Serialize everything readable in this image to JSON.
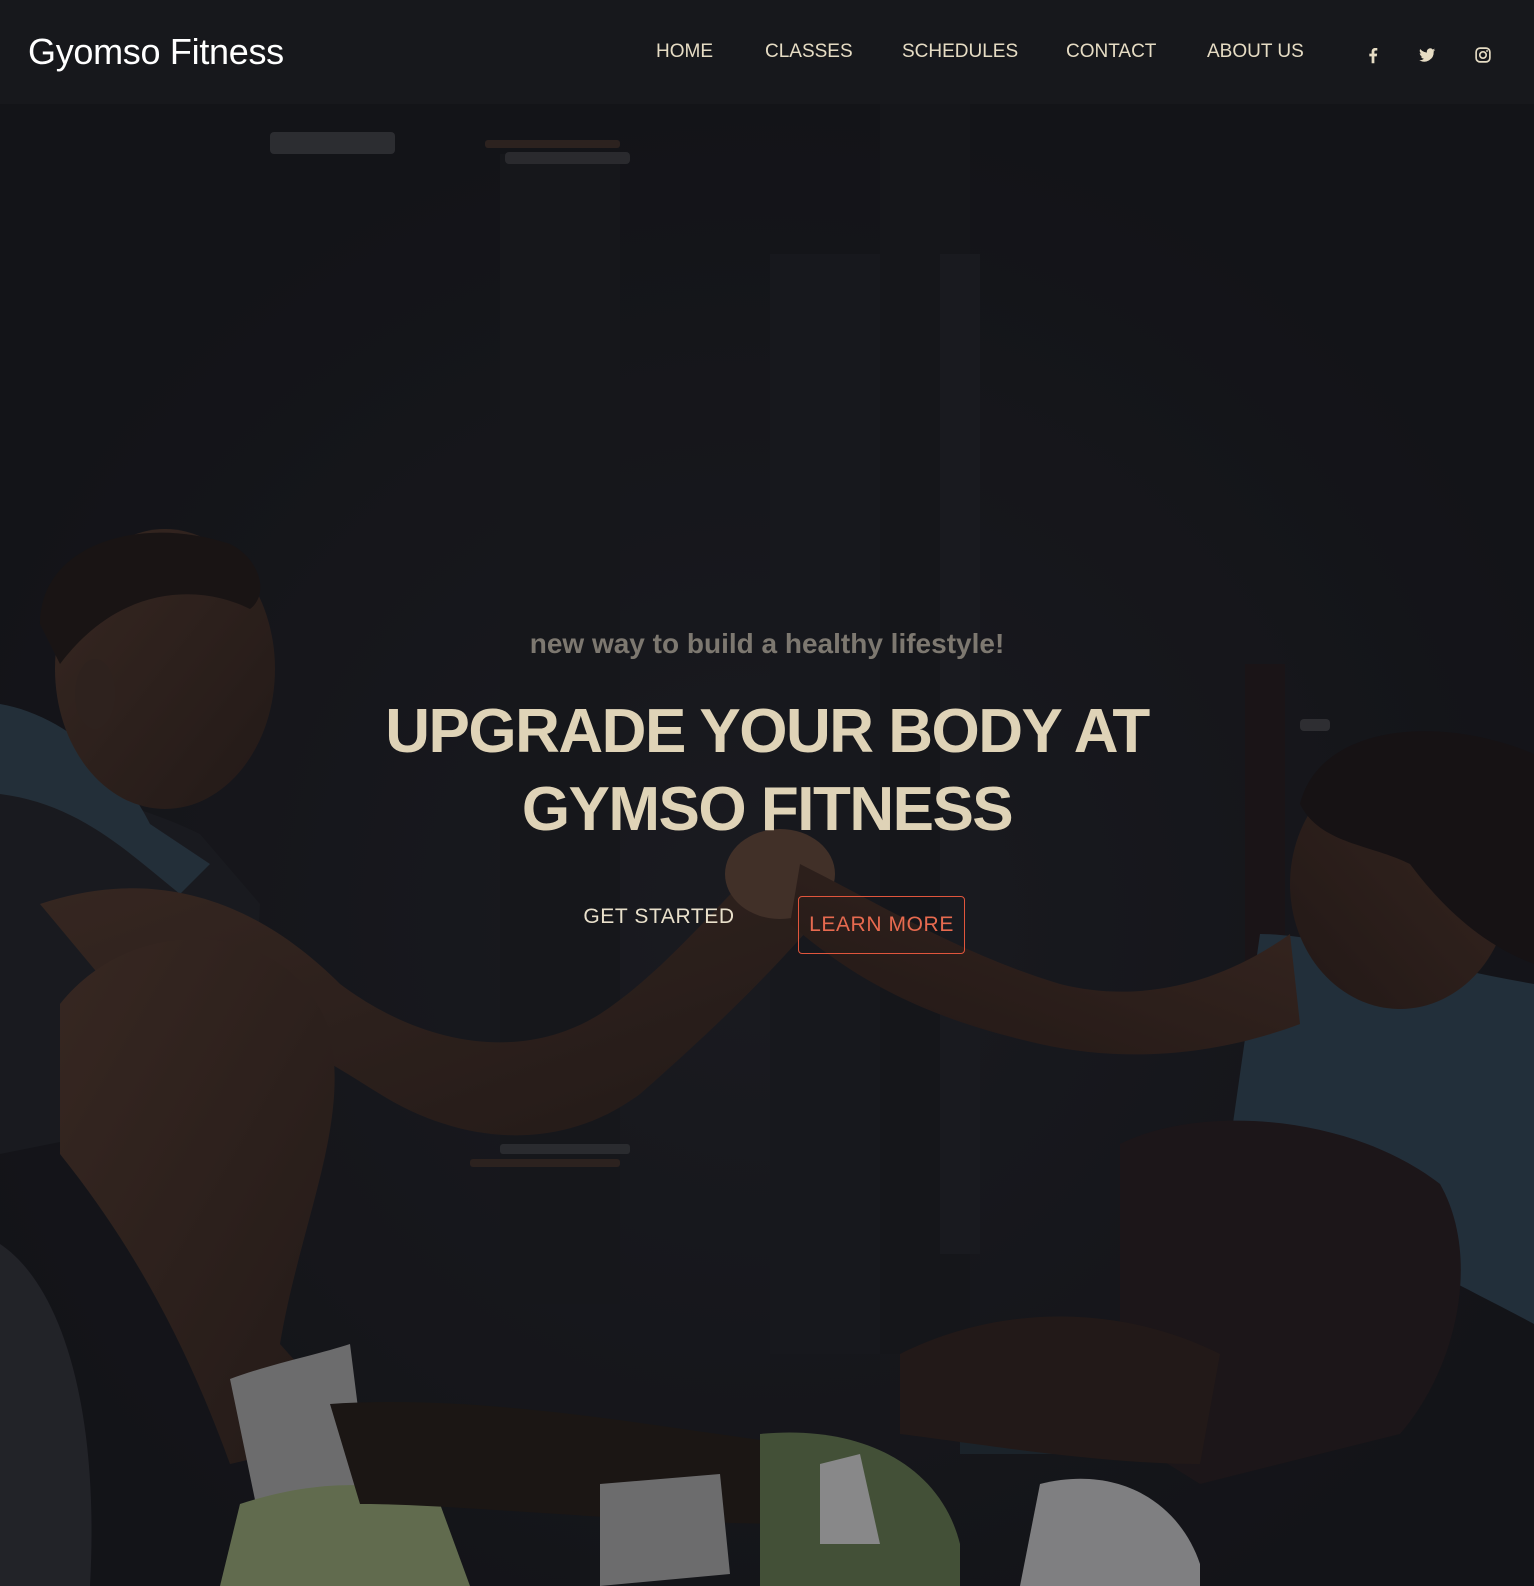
{
  "brand": {
    "name": "Gyomso Fitness"
  },
  "nav": {
    "items": [
      {
        "label": "HOME"
      },
      {
        "label": "CLASSES"
      },
      {
        "label": "SCHEDULES"
      },
      {
        "label": "CONTACT"
      },
      {
        "label": "ABOUT US"
      }
    ],
    "social": [
      {
        "icon": "facebook-icon"
      },
      {
        "icon": "twitter-icon"
      },
      {
        "icon": "instagram-icon"
      }
    ]
  },
  "hero": {
    "tagline": "new way to build a healthy lifestyle!",
    "headline": "UPGRADE YOUR BODY AT GYMSO FITNESS",
    "primary_button": "GET STARTED",
    "secondary_button": "LEARN MORE",
    "background_image": "two people in gym clothes clasping hands while sitting on the floor"
  },
  "colors": {
    "background": "#16171b",
    "nav_text": "#e6dcc4",
    "headline": "#dfd3b7",
    "tagline": "#7d7870",
    "accent": "#e0553c"
  }
}
